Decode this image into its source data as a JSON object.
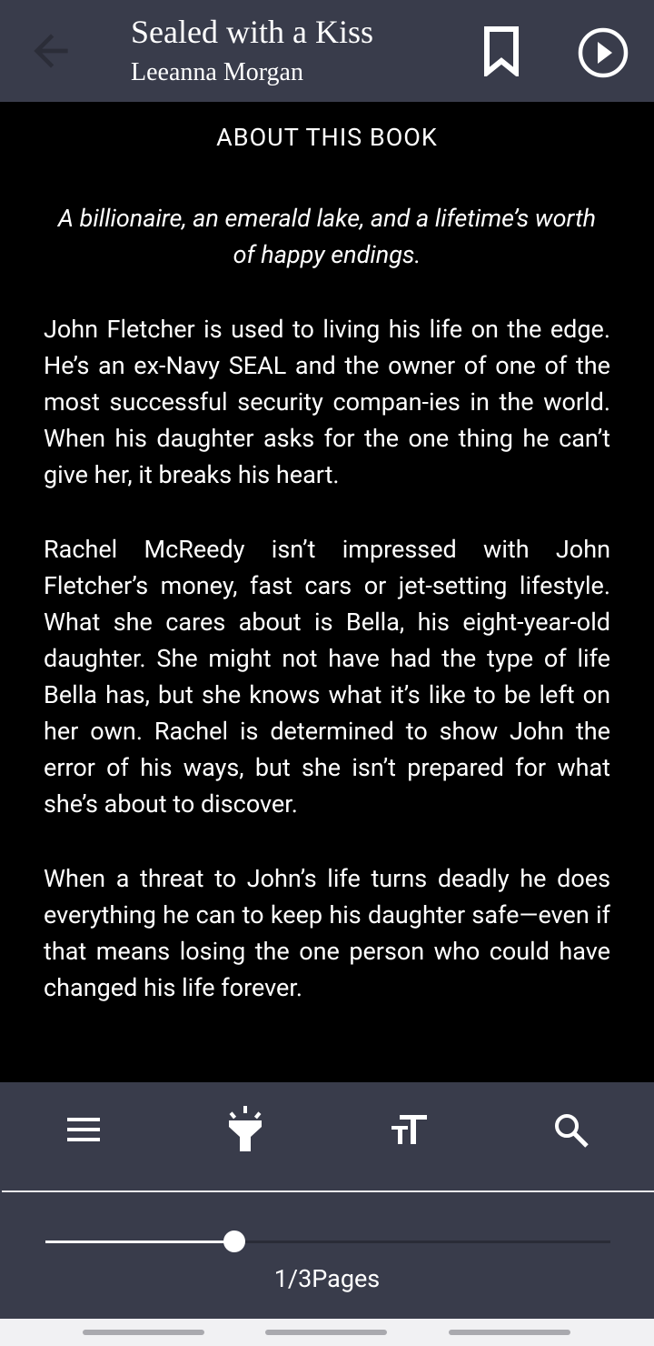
{
  "header": {
    "title": "Sealed with a Kiss",
    "author": "Leeanna Morgan",
    "icons": {
      "back": "arrow-left-icon",
      "bookmark": "bookmark-icon",
      "play": "play-circle-icon"
    }
  },
  "content": {
    "heading": "ABOUT THIS BOOK",
    "tagline": "A billionaire, an emerald lake, and a lifetime’s worth of happy endings.",
    "paragraphs": [
      "John Fletcher is used to living his life on the edge. He’s an ex-Navy SEAL and the owner of one of the most successful security compan-ies in the world. When his daughter asks for the one thing he can’t give her, it breaks his heart.",
      "Rachel McReedy isn’t impressed with John Fletcher’s money, fast cars or jet-setting lifestyle. What she cares about is Bella, his eight-year-old daughter. She might not have had the type of life Bella has, but she knows what it’s like to be left on her own. Rachel is determined to show John the error of his ways, but she isn’t prepared for what she’s about to discover.",
      "When a threat to John’s life turns deadly he does everything he can to keep his daughter safe—even if that means losing the one person who could have changed his life forever."
    ]
  },
  "toolbar": {
    "icons": [
      "menu-icon",
      "flashlight-icon",
      "text-size-icon",
      "search-icon"
    ],
    "progress_fraction": 0.335,
    "page_label": "1/3Pages"
  },
  "colors": {
    "header_bg": "#393c4b",
    "content_bg": "#000000",
    "text": "#ffffff"
  }
}
